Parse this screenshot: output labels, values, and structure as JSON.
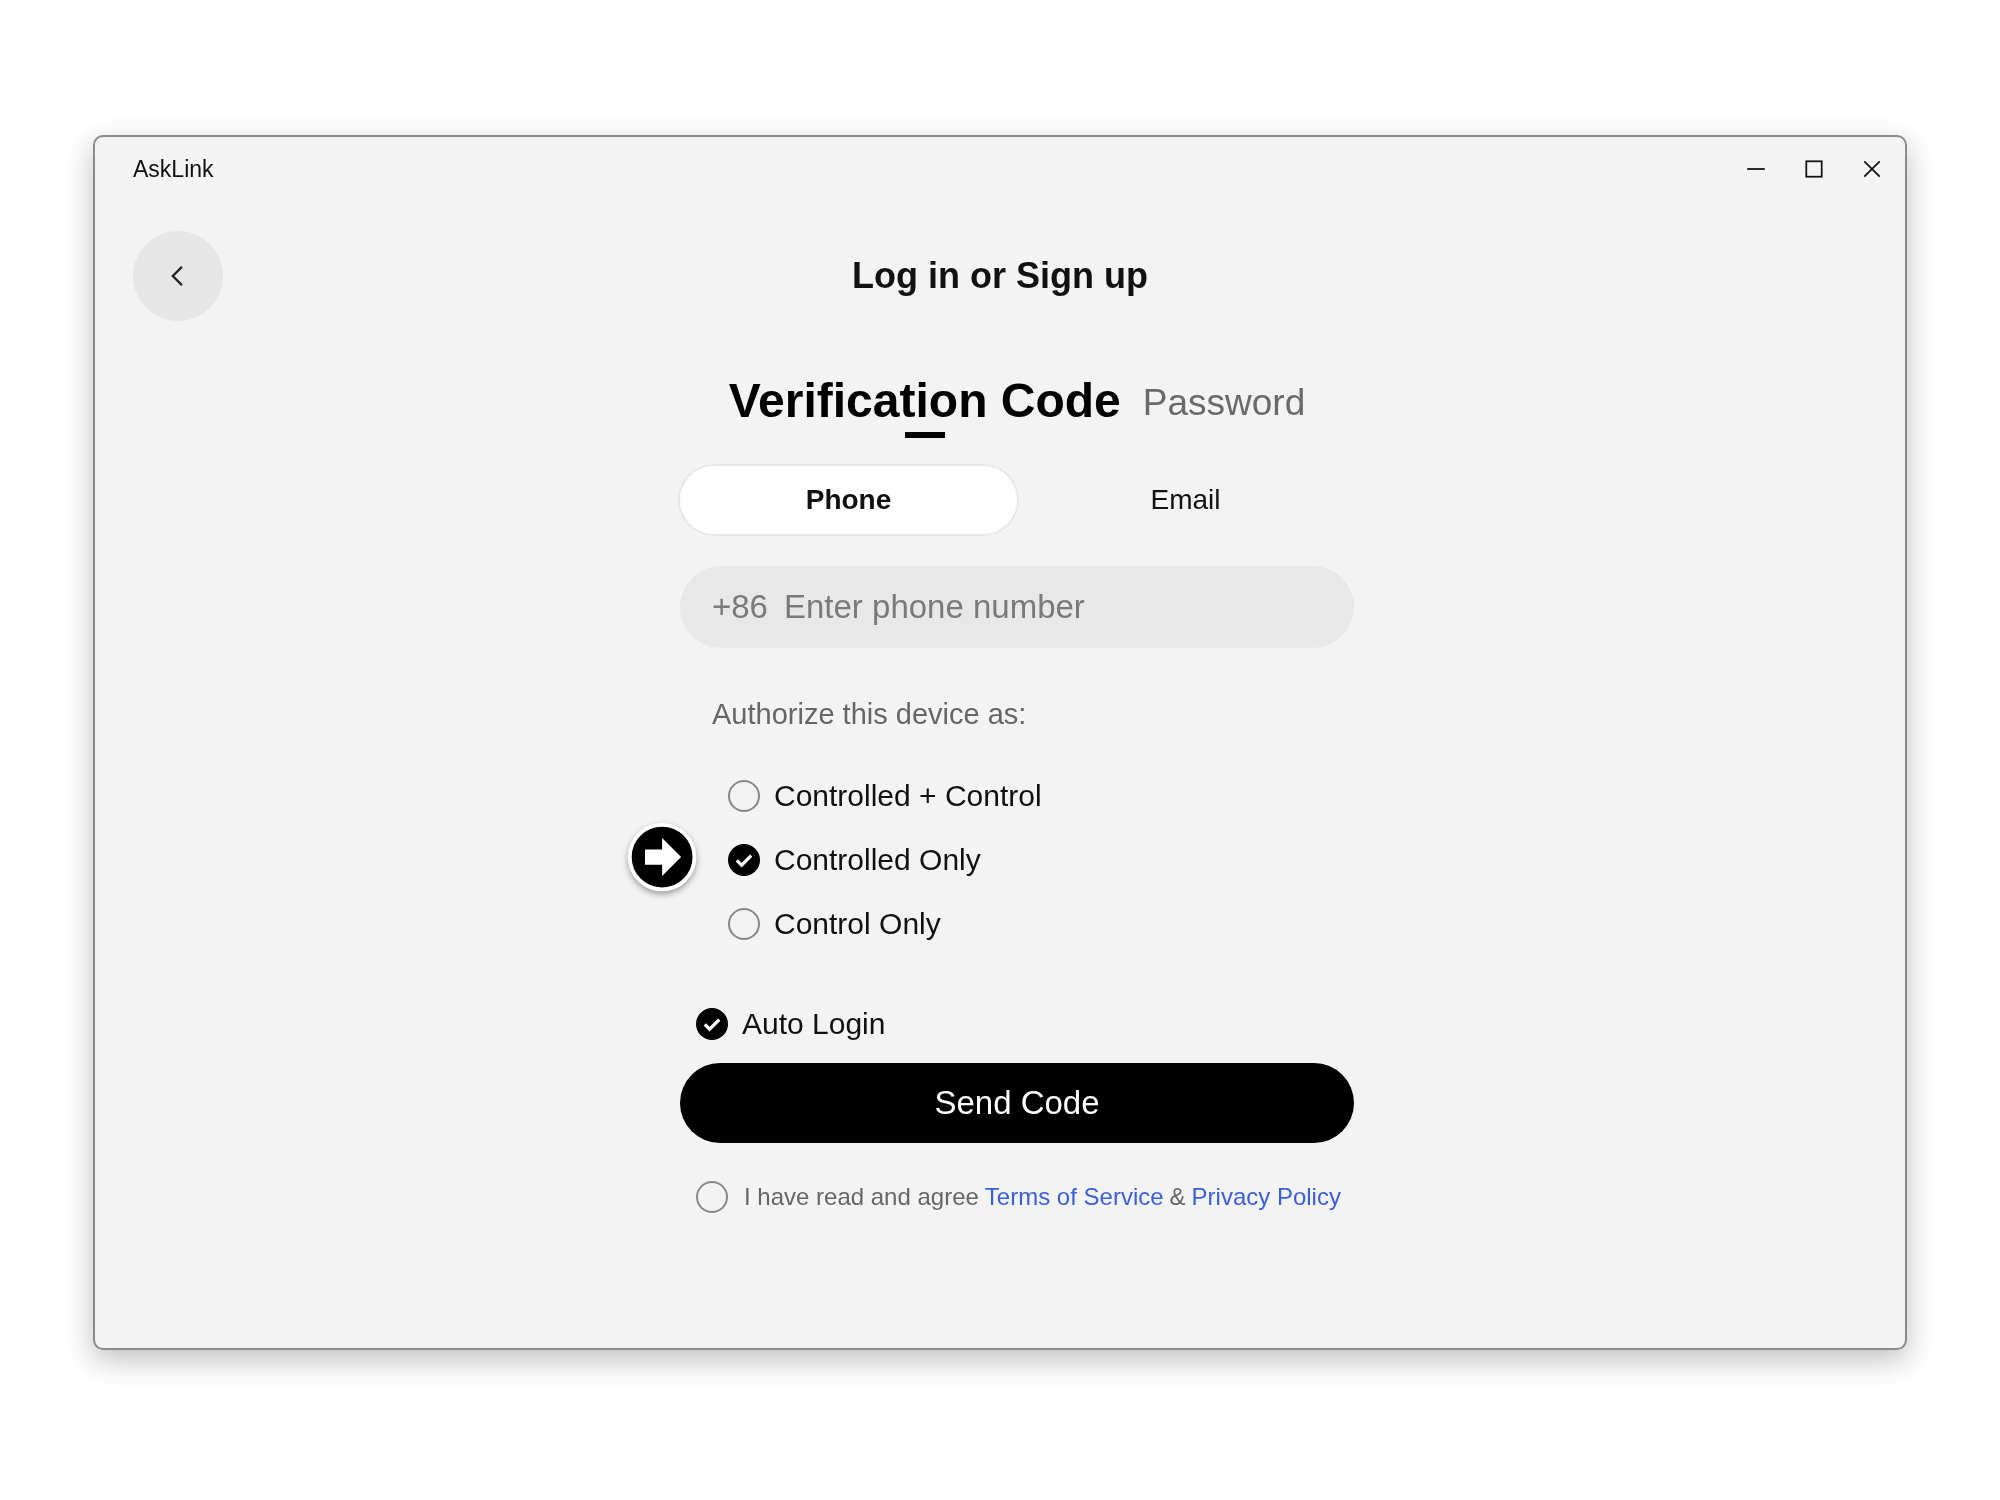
{
  "window": {
    "title": "AskLink"
  },
  "heading": "Log in or Sign up",
  "auth_tabs": [
    {
      "label": "Verification Code",
      "selected": true
    },
    {
      "label": "Password",
      "selected": false
    }
  ],
  "method_tabs": [
    {
      "label": "Phone",
      "selected": true
    },
    {
      "label": "Email",
      "selected": false
    }
  ],
  "phone_field": {
    "prefix": "+86",
    "placeholder": "Enter phone number"
  },
  "authorize_label": "Authorize this device as:",
  "roles": [
    {
      "label": "Controlled + Control",
      "selected": false
    },
    {
      "label": "Controlled Only",
      "selected": true
    },
    {
      "label": "Control Only",
      "selected": false
    }
  ],
  "auto_login": {
    "label": "Auto Login",
    "checked": true
  },
  "send_button": "Send Code",
  "agreement": {
    "checked": false,
    "text": "I have read and agree",
    "terms": "Terms of Service",
    "joiner": "&",
    "privacy": "Privacy Policy"
  }
}
